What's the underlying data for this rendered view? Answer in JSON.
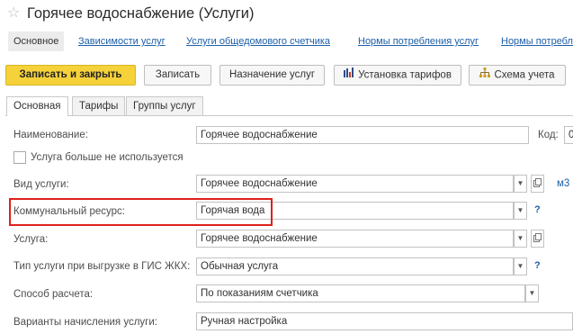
{
  "window": {
    "title": "Горячее водоснабжение (Услуги)"
  },
  "nav": [
    {
      "label": "Основное"
    },
    {
      "label": "Зависимости услуг"
    },
    {
      "label": "Услуги общедомового счетчика"
    },
    {
      "label": "Нормы потребления услуг"
    },
    {
      "label": "Нормы потребле"
    }
  ],
  "toolbar": {
    "save_close": "Записать и закрыть",
    "save": "Записать",
    "assign": "Назначение услуг",
    "tariffs": "Установка тарифов",
    "scheme": "Схема учета"
  },
  "tabs": [
    {
      "label": "Основная"
    },
    {
      "label": "Тарифы"
    },
    {
      "label": "Группы услуг"
    }
  ],
  "form": {
    "name_label": "Наименование:",
    "name_value": "Горячее водоснабжение",
    "code_label": "Код:",
    "code_value": "0",
    "unused_label": "Услуга больше не используется",
    "kind_label": "Вид услуги:",
    "kind_value": "Горячее водоснабжение",
    "unit": "м3",
    "resource_label": "Коммунальный ресурс:",
    "resource_value": "Горячая вода",
    "service_label": "Услуга:",
    "service_value": "Горячее водоснабжение",
    "gis_label": "Тип услуги при выгрузке в ГИС ЖКХ:",
    "gis_value": "Обычная услуга",
    "calc_label": "Способ расчета:",
    "calc_value": "По показаниям счетчика",
    "variants_label": "Варианты начисления услуги:",
    "variants_value": "Ручная настройка",
    "help": "?"
  },
  "icons": {
    "star": "star-icon",
    "tariffs": "bar-chart-icon",
    "scheme": "hierarchy-icon",
    "dropdown": "chevron-down-icon",
    "open": "copy-icon"
  },
  "colors": {
    "primary_button": "#f5d13a",
    "link": "#1d5fa8",
    "highlight": "#e0201b"
  }
}
